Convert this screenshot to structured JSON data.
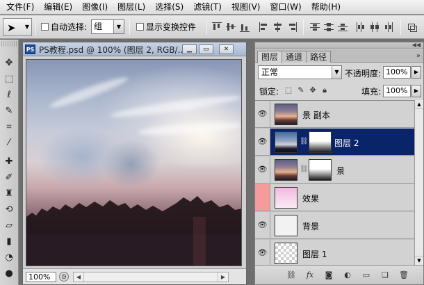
{
  "menu": {
    "items": [
      {
        "name": "menu-file",
        "label": "文件(F)"
      },
      {
        "name": "menu-edit",
        "label": "编辑(E)"
      },
      {
        "name": "menu-image",
        "label": "图像(I)"
      },
      {
        "name": "menu-layer",
        "label": "图层(L)"
      },
      {
        "name": "menu-select",
        "label": "选择(S)"
      },
      {
        "name": "menu-filter",
        "label": "滤镜(T)"
      },
      {
        "name": "menu-view",
        "label": "视图(V)"
      },
      {
        "name": "menu-window",
        "label": "窗口(W)"
      },
      {
        "name": "menu-help",
        "label": "帮助(H)"
      }
    ]
  },
  "options": {
    "tool_icon": "move-tool-icon",
    "auto_select_label": "自动选择:",
    "auto_select_value": "组",
    "show_transform_label": "显示变换控件",
    "auto_select_checked": false,
    "show_transform_checked": false
  },
  "tools": [
    {
      "name": "move-tool-icon",
      "glyph": "✥"
    },
    {
      "name": "marquee-tool-icon",
      "glyph": "⬚"
    },
    {
      "name": "lasso-tool-icon",
      "glyph": "ℓ"
    },
    {
      "name": "quick-select-tool-icon",
      "glyph": "✎"
    },
    {
      "name": "crop-tool-icon",
      "glyph": "⌗"
    },
    {
      "name": "eyedropper-tool-icon",
      "glyph": "⁄"
    },
    {
      "name": "healing-tool-icon",
      "glyph": "✚"
    },
    {
      "name": "brush-tool-icon",
      "glyph": "✐"
    },
    {
      "name": "clone-stamp-tool-icon",
      "glyph": "♜"
    },
    {
      "name": "history-brush-tool-icon",
      "glyph": "⟲"
    },
    {
      "name": "eraser-tool-icon",
      "glyph": "▱"
    },
    {
      "name": "gradient-tool-icon",
      "glyph": "▮"
    },
    {
      "name": "blur-tool-icon",
      "glyph": "◔"
    },
    {
      "name": "dodge-tool-icon",
      "glyph": "●"
    }
  ],
  "document": {
    "icon_label": "PS",
    "title": "PS教程.psd @ 100% (图层 2, RGB/...",
    "minimize": "▁",
    "restore": "▭",
    "close": "✕",
    "zoom": "100%"
  },
  "layers_panel": {
    "tabs": [
      {
        "name": "tab-layers",
        "label": "图层",
        "active": true
      },
      {
        "name": "tab-channels",
        "label": "通道",
        "active": false
      },
      {
        "name": "tab-paths",
        "label": "路径",
        "active": false
      }
    ],
    "menu_icon": "»",
    "blend_mode": "正常",
    "opacity_label": "不透明度:",
    "opacity_value": "100%",
    "lock_label": "锁定:",
    "fill_label": "填充:",
    "fill_value": "100%",
    "layers": [
      {
        "name": "景 副本",
        "thumb": "sunset",
        "mask": false,
        "visible": true,
        "selected": false,
        "effect": false
      },
      {
        "name": "图层 2",
        "thumb": "dusk",
        "mask": true,
        "visible": true,
        "selected": true,
        "effect": false
      },
      {
        "name": "景",
        "thumb": "sunset",
        "mask": true,
        "visible": true,
        "selected": false,
        "effect": false
      },
      {
        "name": "效果",
        "thumb": "pink",
        "mask": false,
        "visible": false,
        "selected": false,
        "effect": true
      },
      {
        "name": "背景",
        "thumb": "white",
        "mask": false,
        "visible": true,
        "selected": false,
        "effect": false
      },
      {
        "name": "图层 1",
        "thumb": "checker",
        "mask": false,
        "visible": true,
        "selected": false,
        "effect": false
      }
    ]
  },
  "colors": {
    "selected_layer": "#0a246a",
    "effect_eye_bg": "#f59b9b",
    "title_bar": "#a8b8d0"
  }
}
